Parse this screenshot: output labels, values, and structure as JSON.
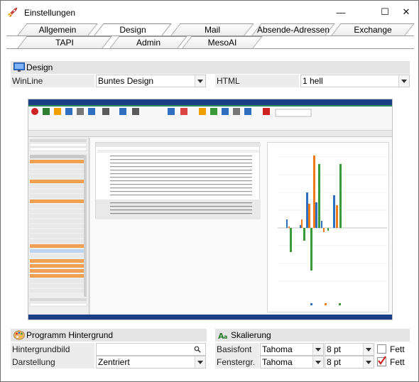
{
  "window": {
    "title": "Einstellungen",
    "min_glyph": "—",
    "max_glyph": "☐",
    "close_glyph": "✕"
  },
  "tabs_row1": [
    {
      "label": "Allgemein",
      "active": false
    },
    {
      "label": "Design",
      "active": true
    },
    {
      "label": "Mail",
      "active": false
    },
    {
      "label": "Absende-Adressen",
      "active": false
    },
    {
      "label": "Exchange",
      "active": false
    }
  ],
  "tabs_row2": [
    {
      "label": "TAPI"
    },
    {
      "label": "Admin"
    },
    {
      "label": "MesoAI"
    }
  ],
  "design_section": {
    "title": "Design",
    "winline_label": "WinLine",
    "winline_value": "Buntes Design",
    "html_label": "HTML",
    "html_value": "1 hell"
  },
  "background_section": {
    "title": "Programm Hintergrund",
    "image_label": "Hintergrundbild",
    "image_value": "",
    "display_label": "Darstellung",
    "display_value": "Zentriert"
  },
  "scaling_section": {
    "title": "Skalierung",
    "base_font_label": "Basisfont",
    "base_font_value": "Tahoma",
    "base_size_value": "8 pt",
    "base_bold_label": "Fett",
    "base_bold_checked": false,
    "window_label": "Fenstergr.",
    "window_font_value": "Tahoma",
    "window_size_value": "8 pt",
    "window_bold_label": "Fett",
    "window_bold_checked": true
  },
  "colors": {
    "accent_blue": "#1a3f86",
    "section_bg": "#e4e4e4",
    "check_red": "#d01818",
    "bar_blue": "#2e6fc0",
    "bar_orange": "#f07a1a",
    "bar_green": "#3a9a3a"
  }
}
